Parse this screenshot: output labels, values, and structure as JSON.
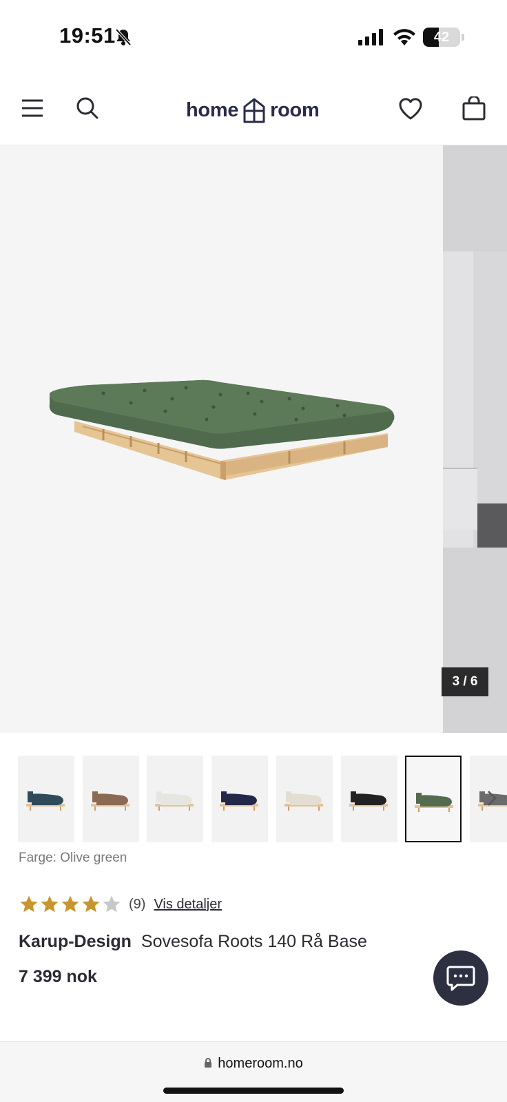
{
  "status_bar": {
    "time": "19:51",
    "battery": "42",
    "battery_level": 0.42,
    "icons": [
      "bell-slash-icon",
      "cellular-signal-icon",
      "wifi-icon",
      "battery-icon"
    ]
  },
  "header": {
    "logo_left": "home",
    "logo_right": "room",
    "icons": [
      "menu-icon",
      "search-icon",
      "heart-icon",
      "shopping-bag-icon"
    ]
  },
  "gallery": {
    "counter": "3 / 6",
    "current_index": 3,
    "total": 6
  },
  "thumbnails": [
    {
      "color": "#2f4b5a"
    },
    {
      "color": "#8a6a52"
    },
    {
      "color": "#e7e5e0"
    },
    {
      "color": "#23284a"
    },
    {
      "color": "#e4ded2"
    },
    {
      "color": "#222222"
    },
    {
      "color": "#556b4f",
      "selected": true
    },
    {
      "color": "#6b6b6b"
    }
  ],
  "product": {
    "color_label": "Farge: Olive green",
    "rating": 4,
    "rating_max": 5,
    "review_count": "(9)",
    "details_link": "Vis detaljer",
    "brand": "Karup-Design",
    "name": "Sovesofa Roots 140 Rå Base",
    "price": "7 399 nok"
  },
  "colors": {
    "star_filled": "#c9952e",
    "star_empty": "#c8c8c8",
    "chat_button": "#2d3040",
    "mattress": "#4f6a4c",
    "wood": "#e8c99a"
  },
  "browser": {
    "url": "homeroom.no"
  }
}
